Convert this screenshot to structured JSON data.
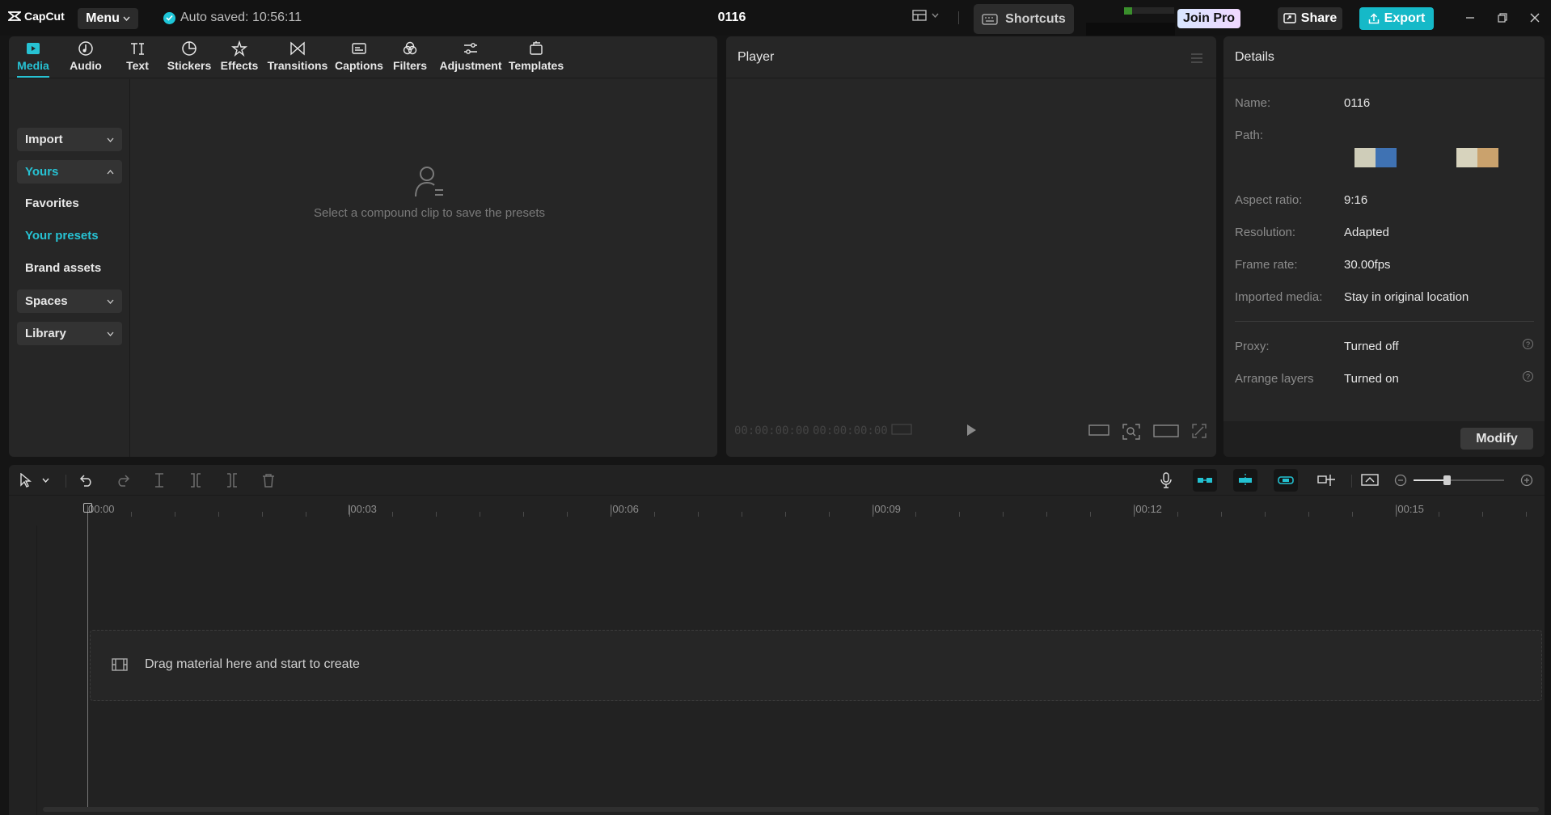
{
  "app": {
    "name": "CapCut",
    "menu_label": "Menu",
    "autosave": "Auto saved: 10:56:11",
    "project_title": "0116"
  },
  "header": {
    "shortcuts_label": "Shortcuts",
    "join_pro_label": "Join Pro",
    "share_label": "Share",
    "export_label": "Export"
  },
  "colors": {
    "accent": "#27c2d3",
    "export": "#15b9c8",
    "panel_bg": "#262626"
  },
  "tabs": [
    {
      "label": "Media",
      "icon": "media-icon"
    },
    {
      "label": "Audio",
      "icon": "audio-icon"
    },
    {
      "label": "Text",
      "icon": "text-icon"
    },
    {
      "label": "Stickers",
      "icon": "stickers-icon"
    },
    {
      "label": "Effects",
      "icon": "effects-icon"
    },
    {
      "label": "Transitions",
      "icon": "transitions-icon"
    },
    {
      "label": "Captions",
      "icon": "captions-icon"
    },
    {
      "label": "Filters",
      "icon": "filters-icon"
    },
    {
      "label": "Adjustment",
      "icon": "adjustment-icon"
    },
    {
      "label": "Templates",
      "icon": "templates-icon"
    }
  ],
  "sidebar": {
    "import": "Import",
    "yours": "Yours",
    "favorites": "Favorites",
    "your_presets": "Your presets",
    "brand_assets": "Brand assets",
    "spaces": "Spaces",
    "library": "Library"
  },
  "media_empty": "Select a compound clip to save the presets",
  "player": {
    "title": "Player",
    "current_time": "00:00:00:00",
    "total_time": "00:00:00:00"
  },
  "details": {
    "title": "Details",
    "rows": [
      {
        "label": "Name:",
        "value": "0116"
      },
      {
        "label": "Path:",
        "value": ""
      },
      {
        "label": "Aspect ratio:",
        "value": "9:16"
      },
      {
        "label": "Resolution:",
        "value": "Adapted"
      },
      {
        "label": "Frame rate:",
        "value": "30.00fps"
      },
      {
        "label": "Imported media:",
        "value": "Stay in original location"
      },
      {
        "label": "Proxy:",
        "value": "Turned off"
      },
      {
        "label": "Arrange layers",
        "value": "Turned on"
      }
    ],
    "path_swatches": [
      [
        "#cfcdb9",
        "#3f72b3"
      ],
      [
        "#d7d3bd",
        "#caa26d"
      ]
    ],
    "modify_label": "Modify"
  },
  "timeline": {
    "ruler_labels": [
      "00:00",
      "|00:03",
      "|00:06",
      "|00:09",
      "|00:12",
      "|00:15"
    ],
    "drop_hint": "Drag material here and start to create"
  }
}
